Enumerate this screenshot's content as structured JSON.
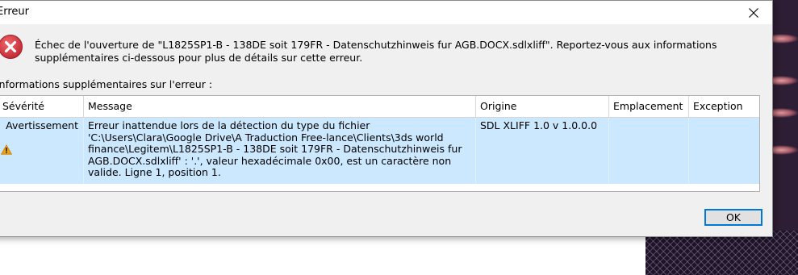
{
  "dialog": {
    "title": "Erreur",
    "message_line1": "Échec de l'ouverture de \"L1825SP1-B - 138DE  soit 179FR - Datenschutzhinweis fur AGB.DOCX.sdlxliff\". Reportez-vous aux informations",
    "message_line2": "supplémentaires ci-dessous pour plus de détails sur cette erreur.",
    "details_label": "Informations supplémentaires sur l'erreur :",
    "ok_label": "OK"
  },
  "table": {
    "headers": [
      "Sévérité",
      "Message",
      "Origine",
      "Emplacement",
      "Exception"
    ],
    "rows": [
      {
        "severity": "Avertissement",
        "message_lines": [
          "Erreur inattendue lors de la détection du type du fichier",
          "'C:\\Users\\Clara\\Google Drive\\A Traduction Free-lance\\Clients\\3ds world",
          "finance\\Legitem\\L1825SP1-B - 138DE  soit 179FR - Datenschutzhinweis fur",
          "AGB.DOCX.sdlxliff' : '.', valeur hexadécimale 0x00, est un caractère non",
          "valide. Ligne 1, position 1."
        ],
        "origin": "SDL XLIFF 1.0 v 1.0.0.0",
        "location": "",
        "exception": ""
      }
    ]
  },
  "icons": {
    "error": "error-icon",
    "warning": "warning-icon",
    "close": "close-icon"
  },
  "colors": {
    "selected_row": "#cce8ff",
    "error_red": "#d9363e",
    "warning_orange": "#f0a30a",
    "ok_border": "#0078d7"
  }
}
